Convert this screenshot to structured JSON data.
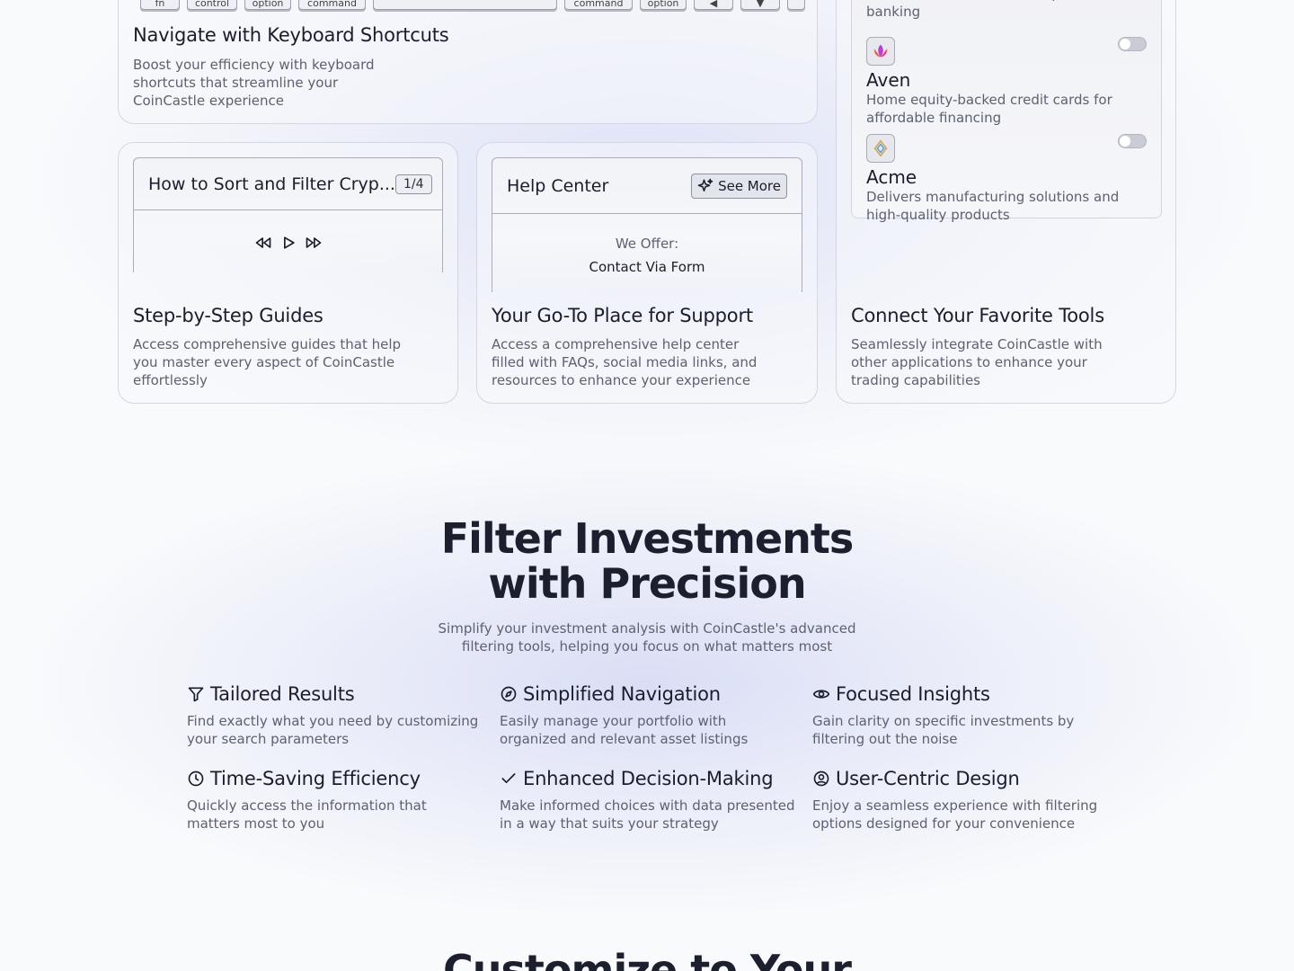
{
  "keyboard_card": {
    "keys": [
      "fn",
      "control",
      "option",
      "command",
      "",
      "command",
      "option",
      "◀",
      "▼",
      ""
    ],
    "title": "Navigate with Keyboard Shortcuts",
    "desc": "Boost your efficiency with keyboard shortcuts that streamline your CoinCastle experience"
  },
  "guides_card": {
    "panel_title": "How to Sort and Filter Cryp...",
    "page_badge": "1/4",
    "title": "Step-by-Step Guides",
    "desc": "Access comprehensive guides that help you master every aspect of CoinCastle effortlessly"
  },
  "help_card": {
    "panel_title": "Help Center",
    "see_more": "See More",
    "offer_label": "We Offer:",
    "offer_value": "Contact Via Form",
    "title": "Your Go-To Place for Support",
    "desc": "Access a comprehensive help center filled with FAQs, social media links, and resources to enhance your experience"
  },
  "integrations_card": {
    "top_desc": "Web-based SaaS for online personal banking",
    "items": [
      {
        "name": "Aven",
        "desc": "Home equity-backed credit cards for affordable financing",
        "enabled": false
      },
      {
        "name": "Acme",
        "desc": "Delivers manufacturing solutions and high-quality products",
        "enabled": false
      }
    ],
    "title": "Connect Your Favorite Tools",
    "desc": "Seamlessly integrate CoinCastle with other applications to enhance your trading capabilities"
  },
  "filter_section": {
    "title_line1": "Filter Investments",
    "title_line2": "with Precision",
    "subtitle": "Simplify your investment analysis with CoinCastle's advanced filtering tools, helping you focus on what matters most",
    "features": [
      {
        "icon": "filter-icon",
        "title": "Tailored Results",
        "desc": "Find exactly what you need by customizing your search parameters"
      },
      {
        "icon": "compass-icon",
        "title": "Simplified Navigation",
        "desc": "Easily manage your portfolio with organized and relevant asset listings"
      },
      {
        "icon": "eye-icon",
        "title": "Focused Insights",
        "desc": "Gain clarity on specific investments by filtering out the noise"
      },
      {
        "icon": "clock-icon",
        "title": "Time-Saving Efficiency",
        "desc": "Quickly access the information that matters most to you"
      },
      {
        "icon": "check-icon",
        "title": "Enhanced Decision-Making",
        "desc": "Make informed choices with data presented in a way that suits your strategy"
      },
      {
        "icon": "user-circle-icon",
        "title": "User-Centric Design",
        "desc": "Enjoy a seamless experience with filtering options designed for your convenience"
      }
    ]
  },
  "next_section": {
    "title": "Customize to Your"
  }
}
